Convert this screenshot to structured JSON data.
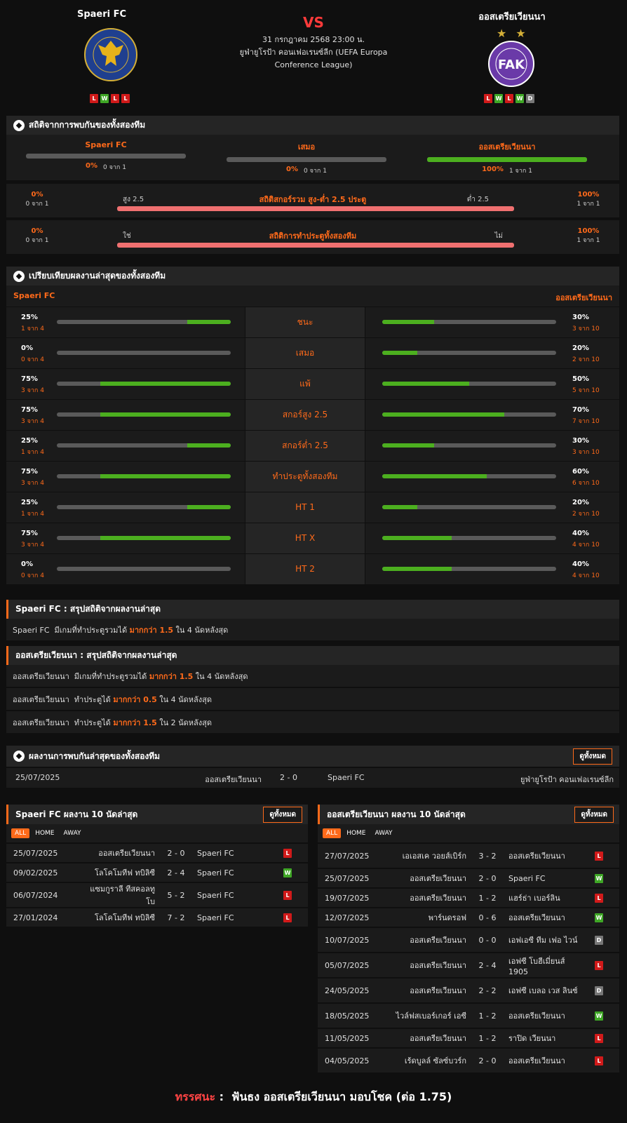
{
  "header": {
    "home_team": "Spaeri FC",
    "away_team": "ออสเตรียเวียนนา",
    "vs": "VS",
    "date": "31 กรกฎาคม 2568 23:00 น.",
    "competition": "ยูฟ่ายูโรป้า คอนเฟอเรนซ์ลีก (UEFA Europa Conference League)",
    "home_form": [
      "L",
      "W",
      "L",
      "L"
    ],
    "away_form": [
      "L",
      "W",
      "L",
      "W",
      "D"
    ],
    "away_stars": "★ ★",
    "home_logo_text": "FOOTBALL CLUB SPAERI",
    "away_logo_text": "FAK"
  },
  "h2h_stats": {
    "title": "สถิติจากการพบกันของทั้งสองทีม",
    "home": {
      "label": "Spaeri FC",
      "pct": "0%",
      "count": "0 จาก 1",
      "value": 0
    },
    "draw": {
      "label": "เสมอ",
      "pct": "0%",
      "count": "0 จาก 1",
      "value": 0
    },
    "away": {
      "label": "ออสเตรียเวียนนา",
      "pct": "100%",
      "count": "1 จาก 1",
      "value": 1
    }
  },
  "over_under": {
    "title": "สถิติสกอร์รวม สูง-ต่ำ 2.5 ประตู",
    "left_label": "สูง 2.5",
    "right_label": "ต่ำ 2.5",
    "left_pct": "0%",
    "left_count": "0 จาก 1",
    "right_pct": "100%",
    "right_count": "1 จาก 1",
    "value": 1
  },
  "btts": {
    "title": "สถิติการทำประตูทั้งสองทีม",
    "left_label": "ใช่",
    "right_label": "ไม่",
    "left_pct": "0%",
    "left_count": "0 จาก 1",
    "right_pct": "100%",
    "right_count": "1 จาก 1",
    "value": 1
  },
  "compare": {
    "title": "เปรียบเทียบผลงานล่าสุดของทั้งสองทีม",
    "home_label": "Spaeri FC",
    "away_label": "ออสเตรียเวียนนา",
    "rows": [
      {
        "label": "ชนะ",
        "hp": "25%",
        "hc": "1 จาก 4",
        "hv": 0.25,
        "ap": "30%",
        "ac": "3 จาก 10",
        "av": 0.3
      },
      {
        "label": "เสมอ",
        "hp": "0%",
        "hc": "0 จาก 4",
        "hv": 0,
        "ap": "20%",
        "ac": "2 จาก 10",
        "av": 0.2
      },
      {
        "label": "แพ้",
        "hp": "75%",
        "hc": "3 จาก 4",
        "hv": 0.75,
        "ap": "50%",
        "ac": "5 จาก 10",
        "av": 0.5
      },
      {
        "label": "สกอร์สูง 2.5",
        "hp": "75%",
        "hc": "3 จาก 4",
        "hv": 0.75,
        "ap": "70%",
        "ac": "7 จาก 10",
        "av": 0.7
      },
      {
        "label": "สกอร์ต่ำ 2.5",
        "hp": "25%",
        "hc": "1 จาก 4",
        "hv": 0.25,
        "ap": "30%",
        "ac": "3 จาก 10",
        "av": 0.3
      },
      {
        "label": "ทำประตูทั้งสองทีม",
        "hp": "75%",
        "hc": "3 จาก 4",
        "hv": 0.75,
        "ap": "60%",
        "ac": "6 จาก 10",
        "av": 0.6
      },
      {
        "label": "HT 1",
        "hp": "25%",
        "hc": "1 จาก 4",
        "hv": 0.25,
        "ap": "20%",
        "ac": "2 จาก 10",
        "av": 0.2
      },
      {
        "label": "HT X",
        "hp": "75%",
        "hc": "3 จาก 4",
        "hv": 0.75,
        "ap": "40%",
        "ac": "4 จาก 10",
        "av": 0.4
      },
      {
        "label": "HT 2",
        "hp": "0%",
        "hc": "0 จาก 4",
        "hv": 0,
        "ap": "40%",
        "ac": "4 จาก 10",
        "av": 0.4
      }
    ]
  },
  "home_summary": {
    "title": "Spaeri FC : สรุปสถิติจากผลงานล่าสุด",
    "lines": [
      {
        "pre": "Spaeri FC  มีเกมที่ทำประตูรวมได้ ",
        "hl": "มากกว่า 1.5",
        "post": " ใน 4 นัดหลังสุด"
      }
    ]
  },
  "away_summary": {
    "title": "ออสเตรียเวียนนา : สรุปสถิติจากผลงานล่าสุด",
    "lines": [
      {
        "pre": "ออสเตรียเวียนนา  มีเกมที่ทำประตูรวมได้ ",
        "hl": "มากกว่า 1.5",
        "post": " ใน 4 นัดหลังสุด"
      },
      {
        "pre": "ออสเตรียเวียนนา  ทำประตูได้ ",
        "hl": "มากกว่า 0.5",
        "post": " ใน 4 นัดหลังสุด"
      },
      {
        "pre": "ออสเตรียเวียนนา  ทำประตูได้ ",
        "hl": "มากกว่า 1.5",
        "post": " ใน 2 นัดหลังสุด"
      }
    ]
  },
  "h2h_results": {
    "title": "ผลงานการพบกันล่าสุดของทั้งสองทีม",
    "view_all": "ดูทั้งหมด",
    "rows": [
      {
        "date": "25/07/2025",
        "home": "ออสเตรียเวียนนา",
        "score": "2 - 0",
        "away": "Spaeri FC",
        "comp": "ยูฟ่ายูโรป้า คอนเฟอเรนซ์ลีก"
      }
    ]
  },
  "home_last10": {
    "title": "Spaeri FC ผลงาน 10 นัดล่าสุด",
    "view_all": "ดูทั้งหมด",
    "tabs": [
      "ALL",
      "HOME",
      "AWAY"
    ],
    "rows": [
      {
        "date": "25/07/2025",
        "home": "ออสเตรียเวียนนา",
        "score": "2 - 0",
        "away": "Spaeri FC",
        "res": "L"
      },
      {
        "date": "09/02/2025",
        "home": "โลโคโมทีฟ ทบิลิซี",
        "score": "2 - 4",
        "away": "Spaeri FC",
        "res": "W"
      },
      {
        "date": "06/07/2024",
        "home": "แซมกูราลี ทีสคอลทูโบ",
        "score": "5 - 2",
        "away": "Spaeri FC",
        "res": "L"
      },
      {
        "date": "27/01/2024",
        "home": "โลโคโมทีฟ ทบิลิซี",
        "score": "7 - 2",
        "away": "Spaeri FC",
        "res": "L"
      }
    ]
  },
  "away_last10": {
    "title": "ออสเตรียเวียนนา ผลงาน 10 นัดล่าสุด",
    "view_all": "ดูทั้งหมด",
    "tabs": [
      "ALL",
      "HOME",
      "AWAY"
    ],
    "rows": [
      {
        "date": "27/07/2025",
        "home": "เอเอสเค วอยส์เบิร์ก",
        "score": "3 - 2",
        "away": "ออสเตรียเวียนนา",
        "res": "L"
      },
      {
        "date": "25/07/2025",
        "home": "ออสเตรียเวียนนา",
        "score": "2 - 0",
        "away": "Spaeri FC",
        "res": "W"
      },
      {
        "date": "19/07/2025",
        "home": "ออสเตรียเวียนนา",
        "score": "1 - 2",
        "away": "แฮร์ธ่า เบอร์ลิน",
        "res": "L"
      },
      {
        "date": "12/07/2025",
        "home": "พาร์นดรอฟ",
        "score": "0 - 6",
        "away": "ออสเตรียเวียนนา",
        "res": "W"
      },
      {
        "date": "10/07/2025",
        "home": "ออสเตรียเวียนนา",
        "score": "0 - 0",
        "away": "เอฟเอซี ทีม เฟอ ไวน์",
        "res": "D"
      },
      {
        "date": "05/07/2025",
        "home": "ออสเตรียเวียนนา",
        "score": "2 - 4",
        "away": "เอฟซี โบฮีเมี่ยนส์ 1905",
        "res": "L"
      },
      {
        "date": "24/05/2025",
        "home": "ออสเตรียเวียนนา",
        "score": "2 - 2",
        "away": "เอฟซี เบลอ เวส ลินซ์",
        "res": "D"
      },
      {
        "date": "18/05/2025",
        "home": "ไวล์ฟสเบอร์เกอร์ เอซี",
        "score": "1 - 2",
        "away": "ออสเตรียเวียนนา",
        "res": "W"
      },
      {
        "date": "11/05/2025",
        "home": "ออสเตรียเวียนนา",
        "score": "1 - 2",
        "away": "ราปิด เวียนนา",
        "res": "L"
      },
      {
        "date": "04/05/2025",
        "home": "เร้ดบูลล์ ซัลซ์บวร์ก",
        "score": "2 - 0",
        "away": "ออสเตรียเวียนนา",
        "res": "L"
      }
    ]
  },
  "prediction": {
    "label": "ทรรศนะ",
    "sep": " :  ",
    "text": "ฟันธง ออสเตรียเวียนนา มอบโชค (ต่อ 1.75)"
  },
  "colors": {
    "accent": "#ff6a1a",
    "win": "#3fa726",
    "loss": "#d11a1a",
    "draw": "#777777",
    "bar_green": "#4caf1f",
    "bar_pink": "#f07070"
  }
}
